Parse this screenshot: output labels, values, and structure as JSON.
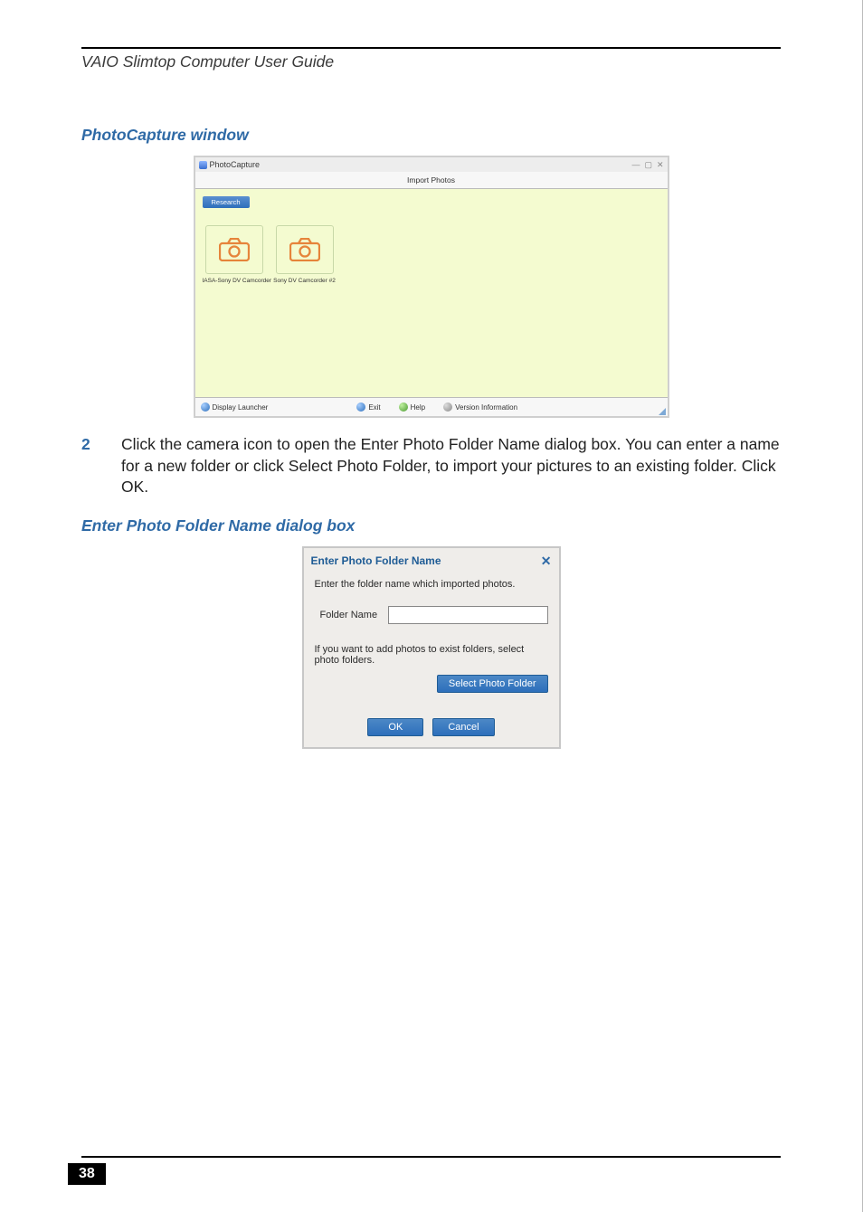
{
  "running_head": "VAIO Slimtop Computer User Guide",
  "heading_photocapture": "PhotoCapture window",
  "photocapture": {
    "title": "PhotoCapture",
    "tab_label": "Import Photos",
    "research_button": "Research",
    "cam1_label": "IASA-Sony DV Camcorder",
    "cam2_label": "Sony DV Camcorder #2",
    "footer_display": "Display Launcher",
    "footer_exit": "Exit",
    "footer_help": "Help",
    "footer_version": "Version Information"
  },
  "step_number": "2",
  "step_text": "Click the camera icon to open the Enter Photo Folder Name dialog box. You can enter a name for a new folder or click Select Photo Folder, to import your pictures to an existing folder. Click OK.",
  "heading_dialog": "Enter Photo Folder Name dialog box",
  "dialog": {
    "title": "Enter Photo Folder Name",
    "instruction": "Enter the folder name which imported photos.",
    "folder_label": "Folder Name",
    "existing_text": "If you want to add photos to exist folders, select photo folders.",
    "select_btn": "Select Photo Folder",
    "ok_btn": "OK",
    "cancel_btn": "Cancel"
  },
  "page_number": "38"
}
